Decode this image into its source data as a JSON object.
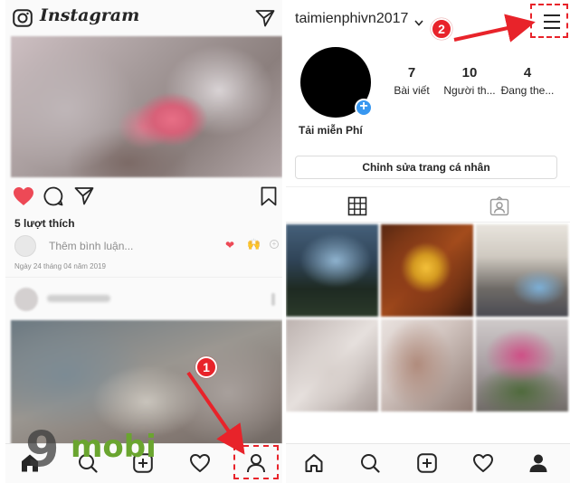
{
  "left": {
    "logo": "Instagram",
    "likes": "5 lượt thích",
    "comment_placeholder": "Thêm bình luận...",
    "emoji_heart": "❤",
    "emoji_hands": "🙌",
    "emoji_plus": "+",
    "date": "Ngày 24 tháng 04 năm 2019"
  },
  "right": {
    "username": "taimienphivn2017",
    "display_name": "Tải miễn Phí",
    "avatar_plus": "+",
    "stats": [
      {
        "value": "7",
        "label": "Bài viết"
      },
      {
        "value": "10",
        "label": "Người th..."
      },
      {
        "value": "4",
        "label": "Đang the..."
      }
    ],
    "edit_profile": "Chỉnh sửa trang cá nhân"
  },
  "annotations": {
    "step1": "1",
    "step2": "2",
    "color": "#e8232a"
  },
  "watermark": {
    "nine": "9",
    "mobi": "mobi",
    "color": "#6aa52f"
  },
  "colors": {
    "like_red": "#ed4956",
    "accent_blue": "#3897f0"
  }
}
